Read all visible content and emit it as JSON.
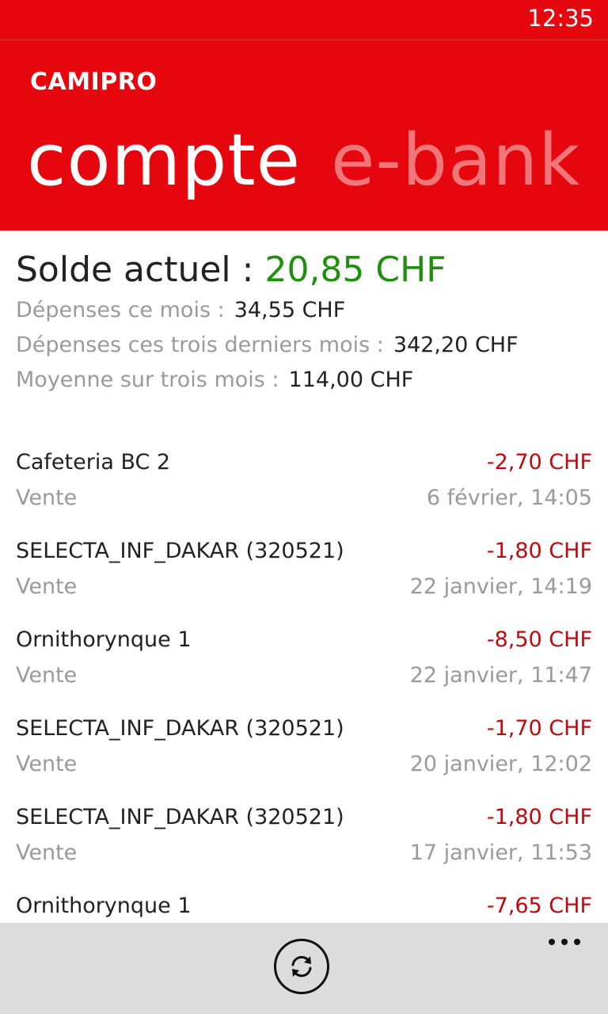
{
  "status_bar": {
    "time": "12:35"
  },
  "header": {
    "app_name": "CAMIPRO",
    "pivots": [
      {
        "label": "compte"
      },
      {
        "label": "e-bank"
      }
    ]
  },
  "summary": {
    "balance_label": "Solde actuel : ",
    "balance_value": "20,85 CHF",
    "stats": [
      {
        "label": "Dépenses ce mois :",
        "value": "34,55 CHF"
      },
      {
        "label": "Dépenses ces trois derniers mois :",
        "value": "342,20 CHF"
      },
      {
        "label": "Moyenne sur trois mois :",
        "value": "114,00 CHF"
      }
    ]
  },
  "transactions": [
    {
      "name": "Cafeteria BC 2",
      "amount": "-2,70 CHF",
      "type": "Vente",
      "date": "6 février, 14:05"
    },
    {
      "name": "SELECTA_INF_DAKAR (320521)",
      "amount": "-1,80 CHF",
      "type": "Vente",
      "date": "22 janvier, 14:19"
    },
    {
      "name": "Ornithorynque 1",
      "amount": "-8,50 CHF",
      "type": "Vente",
      "date": "22 janvier, 11:47"
    },
    {
      "name": "SELECTA_INF_DAKAR (320521)",
      "amount": "-1,70 CHF",
      "type": "Vente",
      "date": "20 janvier, 12:02"
    },
    {
      "name": "SELECTA_INF_DAKAR (320521)",
      "amount": "-1,80 CHF",
      "type": "Vente",
      "date": "17 janvier, 11:53"
    },
    {
      "name": "Ornithorynque 1",
      "amount": "-7,65 CHF",
      "type": "",
      "date": ""
    }
  ],
  "app_bar": {
    "refresh_icon": "refresh-icon",
    "more_icon": "more-icon"
  },
  "colors": {
    "accent": "#e5060e",
    "balance": "#1f8f0e",
    "debit": "#c0080f",
    "muted": "#9a9a9a",
    "app_bar": "#dcdcdc"
  }
}
